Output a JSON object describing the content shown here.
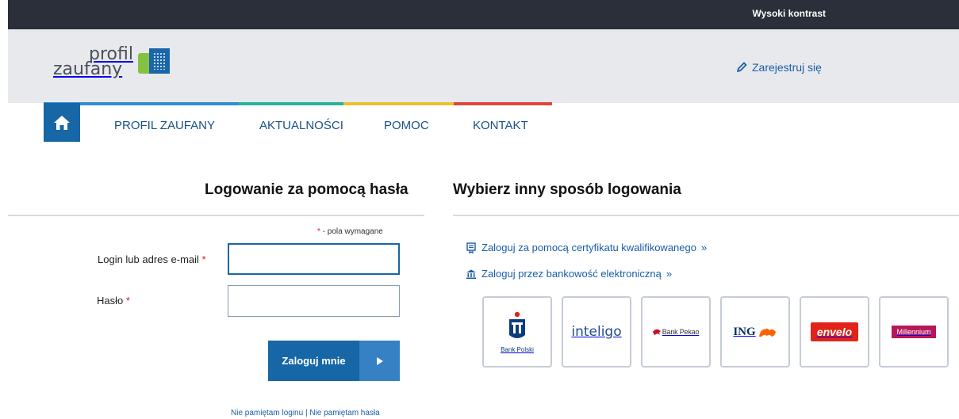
{
  "topbar": {
    "contrast_label": "Wysoki kontrast"
  },
  "header": {
    "logo_line1": "profil",
    "logo_line2": "zaufany",
    "register_label": "Zarejestruj się"
  },
  "nav": {
    "items": [
      {
        "label": "PROFIL ZAUFANY"
      },
      {
        "label": "AKTUALNOŚCI"
      },
      {
        "label": "POMOC"
      },
      {
        "label": "KONTAKT"
      }
    ],
    "colorbar": [
      "#2d8fd6",
      "#27b39a",
      "#e9c22d",
      "#e2453b"
    ]
  },
  "login": {
    "title": "Logowanie za pomocą hasła",
    "required_star": "*",
    "required_note": " - pola wymagane",
    "login_label": "Login lub adres e-mail",
    "login_value": "",
    "password_label": "Hasło",
    "password_value": "",
    "submit_label": "Zaloguj mnie",
    "forgot_login": "Nie pamiętam loginu",
    "separator": " | ",
    "forgot_password": "Nie pamiętam hasła"
  },
  "alt": {
    "title": "Wybierz inny sposób logowania",
    "cert_link": "Zaloguj za pomocą certyfikatu kwalifikowanego",
    "bank_link": "Zaloguj przez bankowość elektroniczną",
    "raquo": "»",
    "banks": [
      {
        "name": "Bank Polski"
      },
      {
        "name": "inteligo"
      },
      {
        "name": "Bank Pekao"
      },
      {
        "name": "ING"
      },
      {
        "name": "envelo"
      },
      {
        "name": "Millennium"
      }
    ]
  },
  "colors": {
    "primary": "#1766a6",
    "topbar": "#2a2f3a",
    "header": "#e8e9ec",
    "link": "#1a5da8"
  }
}
